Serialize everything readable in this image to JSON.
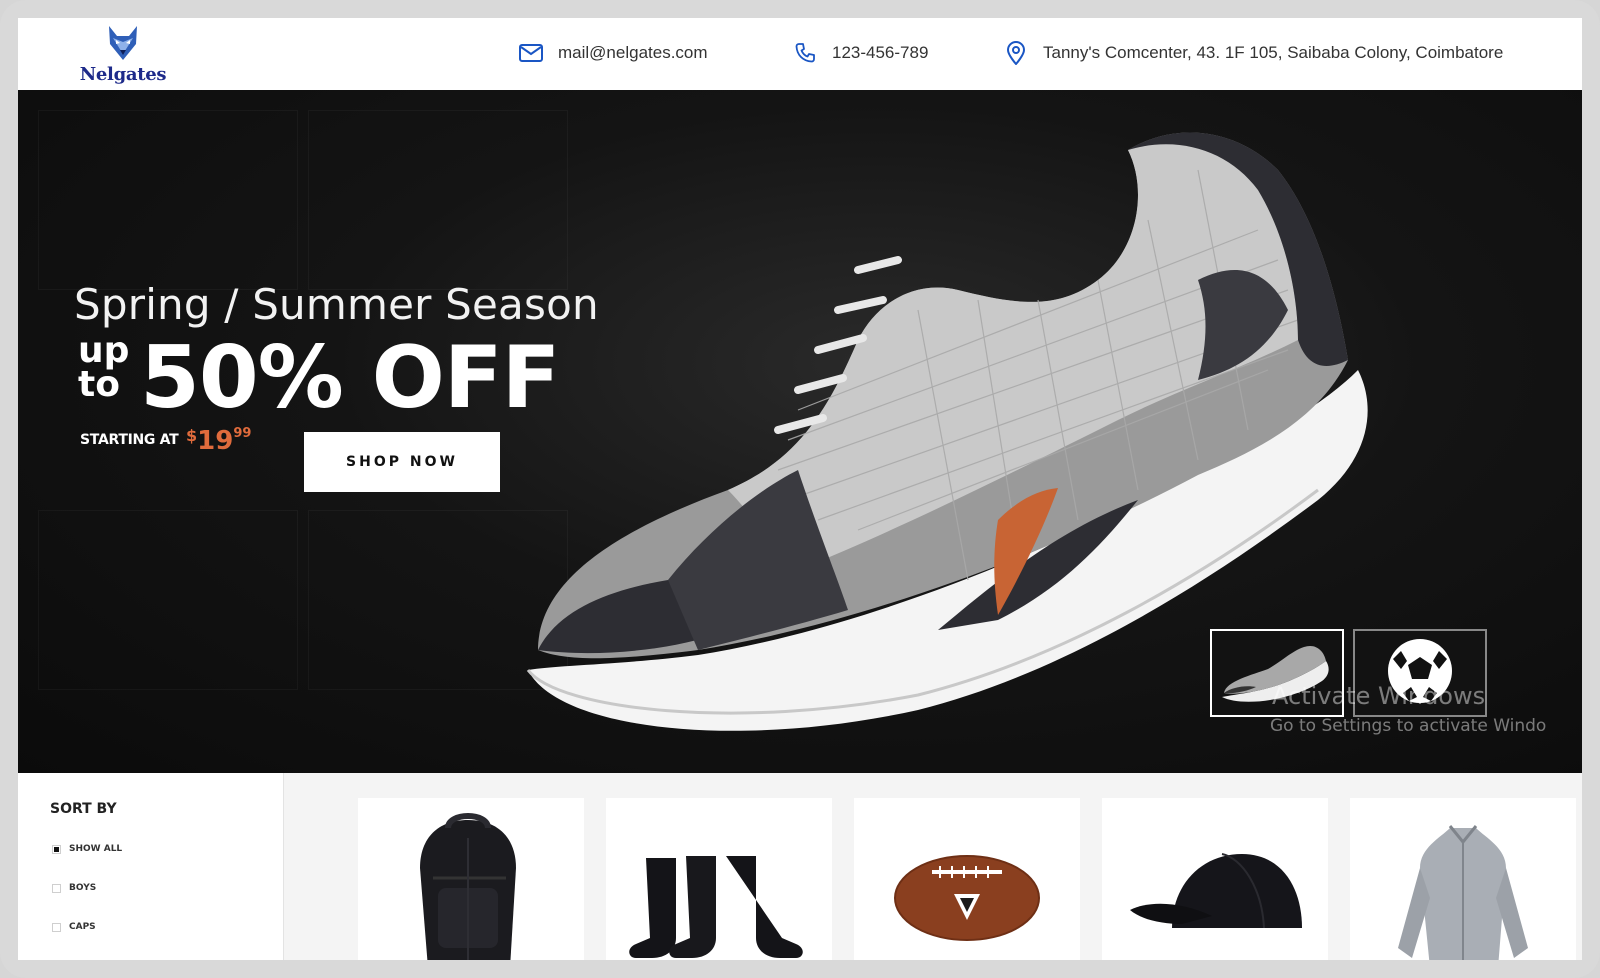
{
  "brand": {
    "name": "Nelgates"
  },
  "contact": {
    "email": "mail@nelgates.com",
    "phone": "123-456-789",
    "address": "Tanny's Comcenter, 43. 1F 105, Saibaba Colony, Coimbatore"
  },
  "hero": {
    "season": "Spring / Summer Season",
    "up": "up",
    "to": "to",
    "discount": "50% OFF",
    "starting_label": "STARTING AT",
    "price_currency": "$",
    "price_whole": "19",
    "price_cents": "99",
    "cta_label": "SHOP NOW",
    "slides": [
      "sneaker",
      "soccer ball"
    ]
  },
  "watermark": {
    "line1": "Activate Windows",
    "line2": "Go to Settings to activate Windo"
  },
  "sidebar": {
    "title": "SORT BY",
    "filters": [
      {
        "label": "SHOW ALL",
        "checked": true
      },
      {
        "label": "BOYS",
        "checked": false
      },
      {
        "label": "CAPS",
        "checked": false
      }
    ]
  },
  "products": [
    "backpack",
    "socks",
    "football",
    "cap",
    "jacket"
  ],
  "colors": {
    "accent": "#e06b3c",
    "brand": "#1d2a8a",
    "icon": "#1a56c4"
  }
}
